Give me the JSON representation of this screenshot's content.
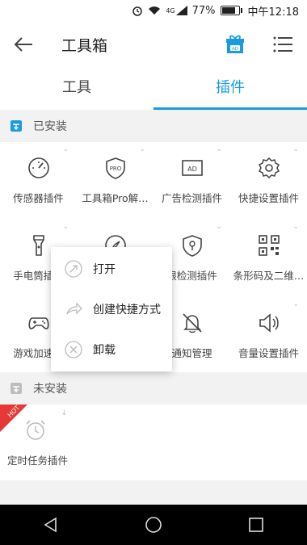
{
  "status": {
    "signal": "4G",
    "battery": "77%",
    "time": "中午12:18"
  },
  "header": {
    "title": "工具箱"
  },
  "tabs": [
    {
      "label": "工具",
      "active": false
    },
    {
      "label": "插件",
      "active": true
    }
  ],
  "installed": {
    "heading": "已安装",
    "items": [
      {
        "label": "传感器插件",
        "icon": "speedometer-icon"
      },
      {
        "label": "工具箱Pro解…",
        "icon": "pro-shield-icon"
      },
      {
        "label": "广告检测插件",
        "icon": "ad-icon"
      },
      {
        "label": "快捷设置插件",
        "icon": "gear-icon"
      },
      {
        "label": "手电筒插件",
        "icon": "flashlight-icon"
      },
      {
        "label": "",
        "icon": "compass-icon"
      },
      {
        "label": "限检测插件",
        "icon": "location-shield-icon"
      },
      {
        "label": "条形码及二维…",
        "icon": "qr-code-icon"
      },
      {
        "label": "游戏加速插",
        "icon": "gamepad-icon"
      },
      {
        "label": "",
        "icon": ""
      },
      {
        "label": "通知管理",
        "icon": "bell-off-icon"
      },
      {
        "label": "音量设置插件",
        "icon": "volume-icon"
      }
    ]
  },
  "not_installed": {
    "heading": "未安装",
    "items": [
      {
        "label": "定时任务插件",
        "icon": "alarm-clock-icon",
        "badge": "HOT"
      }
    ]
  },
  "context_menu": {
    "items": [
      {
        "label": "打开",
        "icon": "open-arrow-icon"
      },
      {
        "label": "创建快捷方式",
        "icon": "share-arrow-icon"
      },
      {
        "label": "卸载",
        "icon": "close-circle-icon"
      }
    ]
  },
  "colors": {
    "accent": "#1a9be0",
    "installed_icon": "#1a9be0",
    "not_installed_icon": "#bdbdbd",
    "hot_badge": "#e53935"
  }
}
